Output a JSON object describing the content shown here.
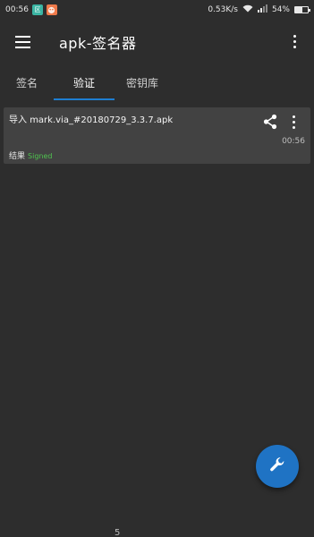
{
  "statusbar": {
    "time": "00:56",
    "badge_a": "区",
    "net_speed": "0.53K/s",
    "battery": "54%",
    "battery_level": 0.54
  },
  "appbar": {
    "title": "apk-签名器"
  },
  "tabs": [
    {
      "label": "签名",
      "active": false
    },
    {
      "label": "验证",
      "active": true
    },
    {
      "label": "密钥库",
      "active": false
    }
  ],
  "card": {
    "prefix": "导入",
    "filename": "mark.via_#20180729_3.3.7.apk",
    "time": "00:56",
    "result_label": "结果",
    "result_status": "Signed"
  },
  "fab": {
    "icon": "wrench-icon"
  },
  "bottom_mark": "5",
  "colors": {
    "background": "#2d2d2d",
    "card": "#424242",
    "accent": "#1f73c4",
    "tab_indicator": "#1e7ed1",
    "status_ok": "#4fc34f"
  }
}
